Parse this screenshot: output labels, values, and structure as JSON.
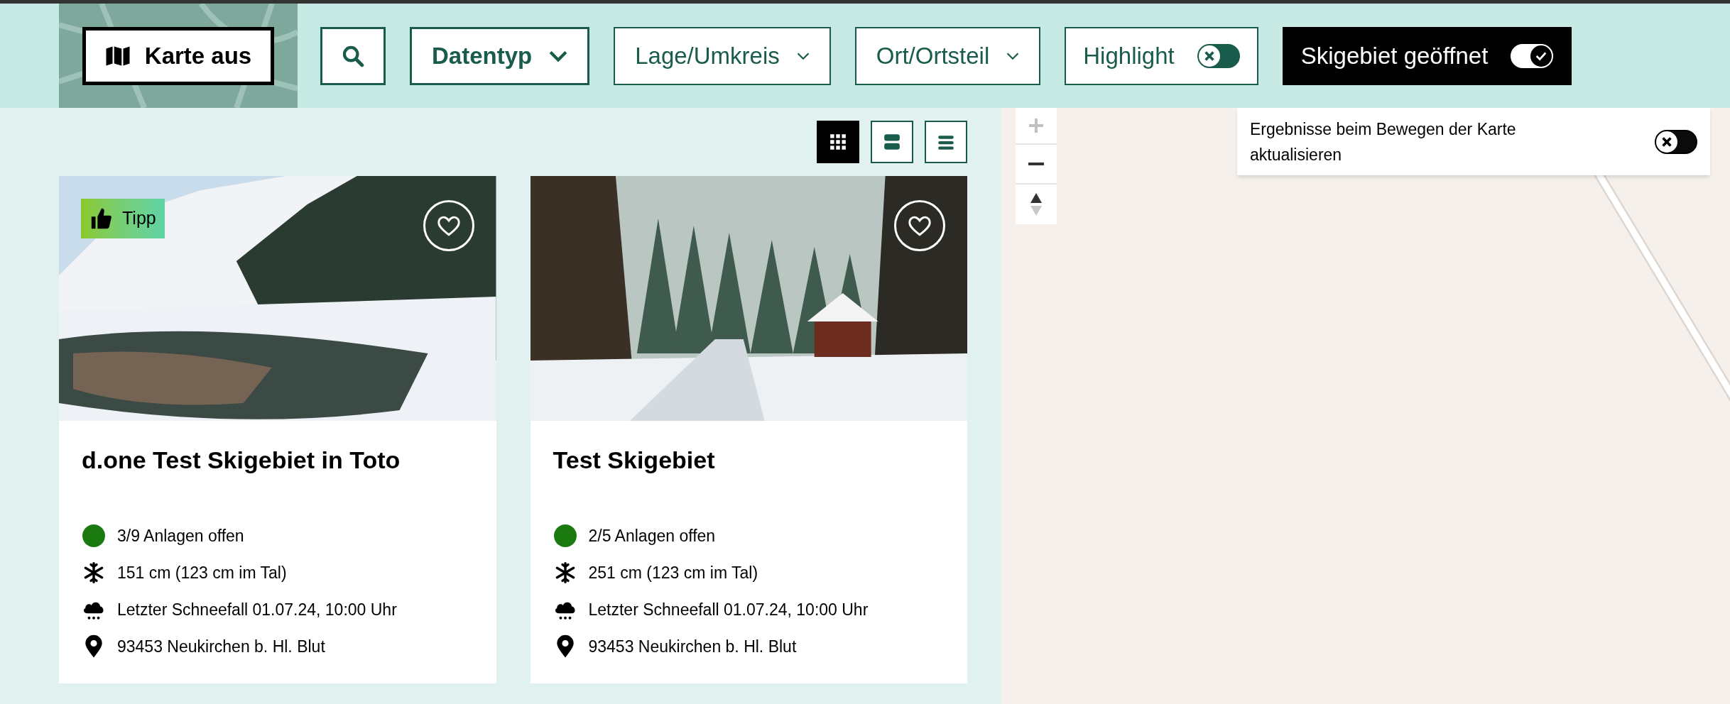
{
  "toolbar": {
    "map_toggle": {
      "label": "Karte aus"
    },
    "filters": [
      {
        "kind": "search"
      },
      {
        "kind": "select",
        "label": "Datentyp"
      },
      {
        "kind": "dropdown",
        "label": "Lage/Umkreis"
      },
      {
        "kind": "dropdown",
        "label": "Ort/Ortsteil"
      },
      {
        "kind": "switch",
        "label": "Highlight",
        "on": false
      },
      {
        "kind": "switch",
        "label": "Skigebiet geöffnet",
        "on": true
      }
    ]
  },
  "view_modes": [
    {
      "kind": "grid",
      "selected": true
    },
    {
      "kind": "tiles",
      "selected": false
    },
    {
      "kind": "list",
      "selected": false
    }
  ],
  "cards": [
    {
      "badge": "Tipp",
      "favorite": false,
      "title": "d.one Test Skigebiet in Toto",
      "lifts": "3/9 Anlagen offen",
      "color": "#1a7a10",
      "snow": "151 cm (123 cm im Tal)",
      "snowfall": "Letzter Schneefall 01.07.24, 10:00 Uhr",
      "location": "93453 Neukirchen b. Hl. Blut"
    },
    {
      "favorite": false,
      "title": "Test Skigebiet",
      "lifts": "2/5 Anlagen offen",
      "color": "#1a7a10",
      "snow": "251 cm (123 cm im Tal)",
      "snowfall": "Letzter Schneefall 01.07.24, 10:00 Uhr",
      "location": "93453 Neukirchen b. Hl. Blut"
    }
  ],
  "map": {
    "update_on_move": {
      "label": "Ergebnisse beim Bewegen der Karte aktualisieren",
      "on": false
    }
  }
}
